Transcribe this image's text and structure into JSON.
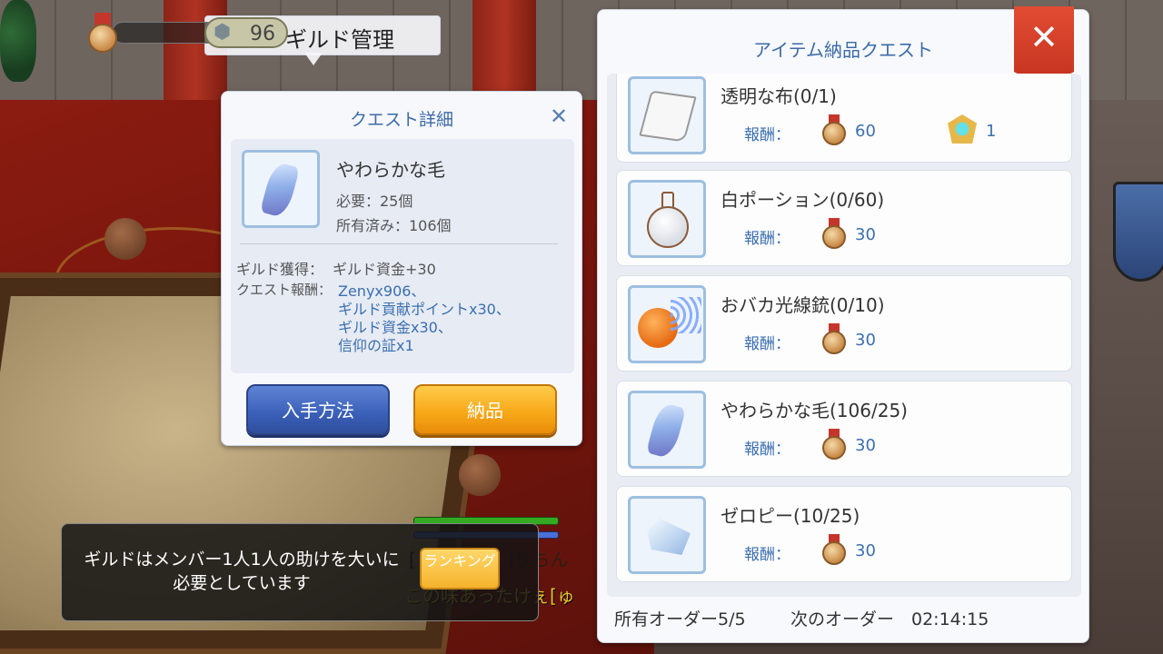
{
  "guild": {
    "level": "96",
    "title": "ギルド管理"
  },
  "quest_detail": {
    "title": "クエスト詳細",
    "item_name": "やわらかな毛",
    "required": "必要：25個",
    "owned": "所有済み：106個",
    "guild_gain_label": "ギルド獲得：",
    "guild_gain_value": "ギルド資金+30",
    "reward_label": "クエスト報酬：",
    "rewards": [
      "Zenyx906、",
      "ギルド貢献ポイントx30、",
      "ギルド資金x30、",
      "信仰の証x1"
    ],
    "howto_button": "入手方法",
    "deliver_button": "納品"
  },
  "delivery_panel": {
    "title": "アイテム納品クエスト",
    "reward_label": "報酬：",
    "items": [
      {
        "name": "透明な布(0/1)",
        "icon": "cloth-icon",
        "reward": "60",
        "extra": "1"
      },
      {
        "name": "白ポーション(0/60)",
        "icon": "white-potion-icon",
        "reward": "30"
      },
      {
        "name": "おバカ光線銃(0/10)",
        "icon": "ray-gun-icon",
        "reward": "30"
      },
      {
        "name": "やわらかな毛(106/25)",
        "icon": "soft-feather-icon",
        "reward": "30"
      },
      {
        "name": "ゼロピー(10/25)",
        "icon": "jellopy-icon",
        "reward": "30"
      }
    ],
    "orders": "所有オーダー5/5",
    "next_order": "次のオーダー　02:14:15"
  },
  "message": {
    "text": "ギルドはメンバー1人1人の助けを大いに必要としています",
    "ranking_button": "ランキング"
  },
  "world": {
    "character_name": "[　　　　　]りちん",
    "chat": "この味あったけぇ[ゅ"
  },
  "colors": {
    "title_blue": "#3d6aa8",
    "reward_blue": "#3b6fb0",
    "close_red": "#d63f2a",
    "howto_blue": "#3a5fb7",
    "deliver_orange": "#f7a616"
  }
}
